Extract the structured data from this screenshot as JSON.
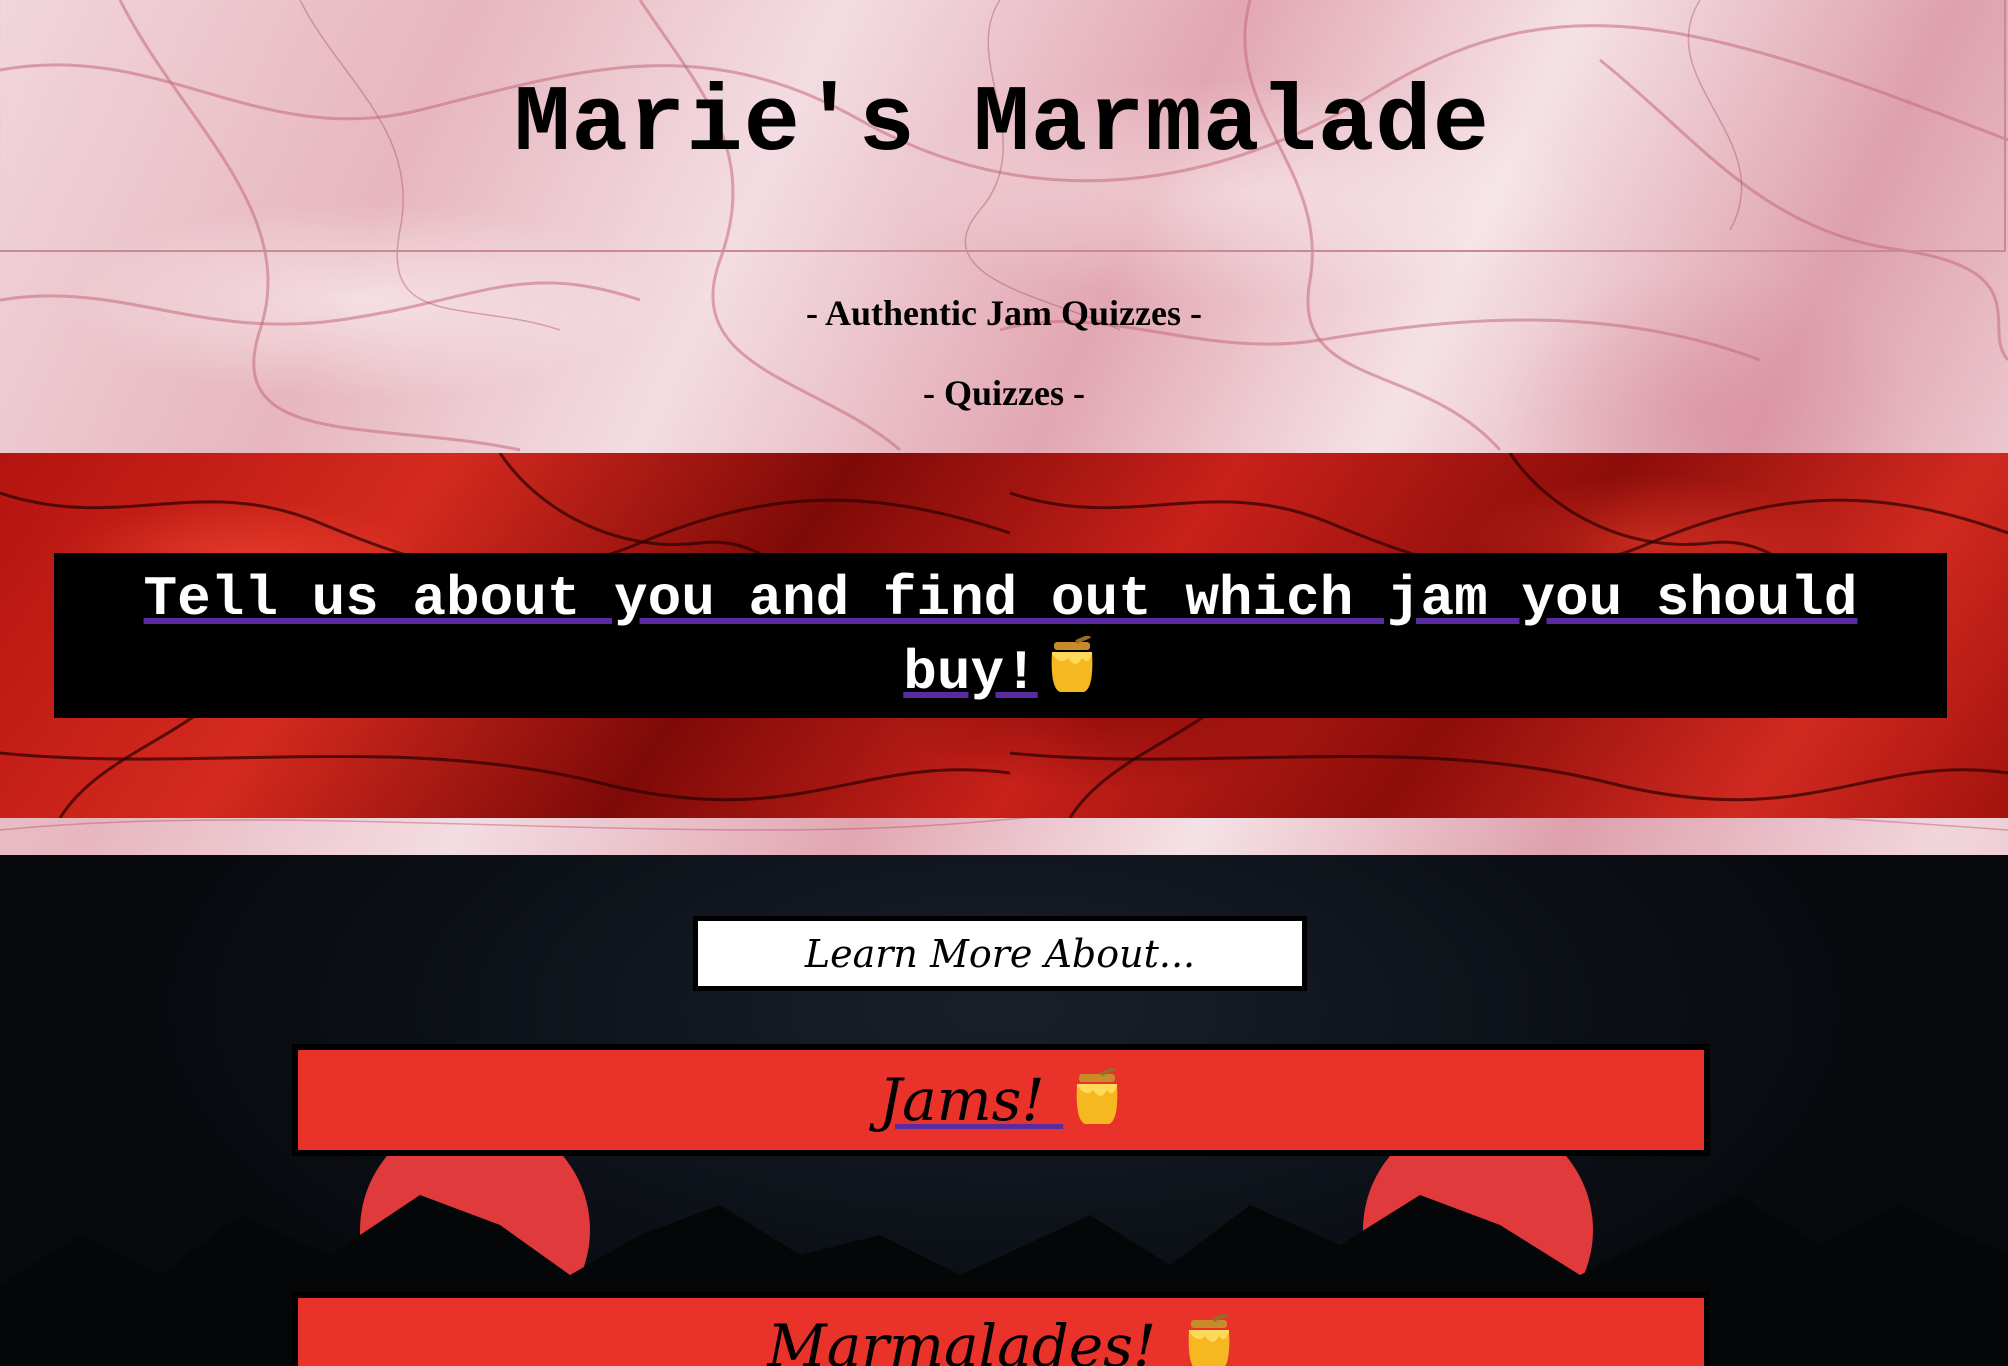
{
  "header": {
    "title": "Marie's Marmalade"
  },
  "subnav": {
    "tagline": "- Authentic Jam Quizzes -",
    "quizzes": "- Quizzes -"
  },
  "cta": {
    "text": "Tell us about you and find out which jam you should buy!",
    "icon": "honey-pot-icon"
  },
  "learn_more": {
    "label": "Learn More About..."
  },
  "topics": [
    {
      "label": "Jams!",
      "icon": "honey-pot-icon"
    },
    {
      "label": "Marmalades!",
      "icon": "honey-pot-icon"
    }
  ],
  "colors": {
    "marble_pink": "#ecc4cc",
    "band_red": "#c0201a",
    "button_red": "#e8322a",
    "dark_bg": "#0d1118",
    "link_underline": "#5a2aa0"
  }
}
